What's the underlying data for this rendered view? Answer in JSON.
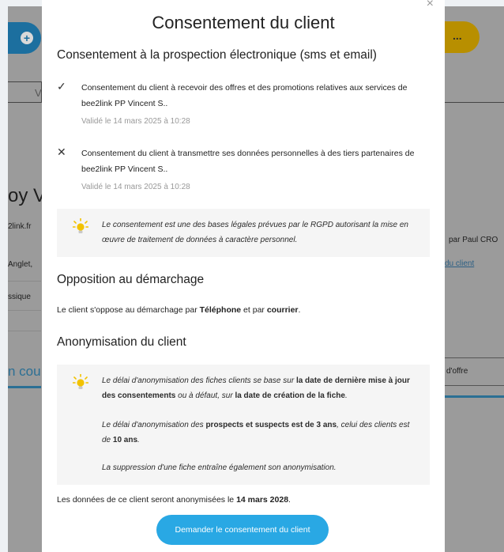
{
  "background": {
    "more_label": "...",
    "plus_label": "+",
    "tab_fragment": "V",
    "big_text_fragment": "oy V",
    "email_fragment": "2link.fr",
    "city_fragment": "Anglet,",
    "type_fragment": "ssique",
    "right_author_fragment": "par Paul CRO",
    "right_link_fragment": "du client",
    "courses_fragment": "n cou",
    "offer_fragment": "d'offre"
  },
  "modal": {
    "title": "Consentement du client",
    "close_icon": "×",
    "section1": {
      "heading": "Consentement à la prospection électronique (sms et email)",
      "items": [
        {
          "icon": "✓",
          "text": "Consentement du client à recevoir des offres et des promotions relatives aux services de bee2link PP Vincent S..",
          "date": "Validé le 14 mars 2025 à 10:28"
        },
        {
          "icon": "✕",
          "text": "Consentement du client à transmettre ses données personnelles à des tiers partenaires de bee2link PP Vincent S..",
          "date": "Validé le 14 mars 2025 à 10:28"
        }
      ],
      "info": "Le consentement est une des bases légales prévues par le RGPD autorisant la mise en œuvre de traitement de données à caractère personnel."
    },
    "section2": {
      "heading": "Opposition au démarchage",
      "text_prefix": "Le client s'oppose au démarchage par ",
      "channel1": "Téléphone",
      "text_middle": " et par ",
      "channel2": "courrier",
      "text_suffix": "."
    },
    "section3": {
      "heading": "Anonymisation du client",
      "para1": {
        "a": "Le délai d'anonymisation des fiches clients se base sur ",
        "b": "la date de dernière mise à jour des consentements",
        "c": " ou à défaut, sur ",
        "d": "la date de création de la fiche",
        "e": "."
      },
      "para2": {
        "a": "Le délai d'anonymisation des ",
        "b": "prospects et suspects est de 3 ans",
        "c": ", celui des clients est de ",
        "d": "10 ans",
        "e": "."
      },
      "para3": "La suppression d'une fiche entraîne également son anonymisation.",
      "footer_prefix": "Les données de ce client seront anonymisées le ",
      "footer_date": "14 mars 2028",
      "footer_suffix": "."
    },
    "button_label": "Demander le consentement du client"
  },
  "colors": {
    "primary_button": "#29a8e4",
    "bulb": "#f2c200"
  }
}
